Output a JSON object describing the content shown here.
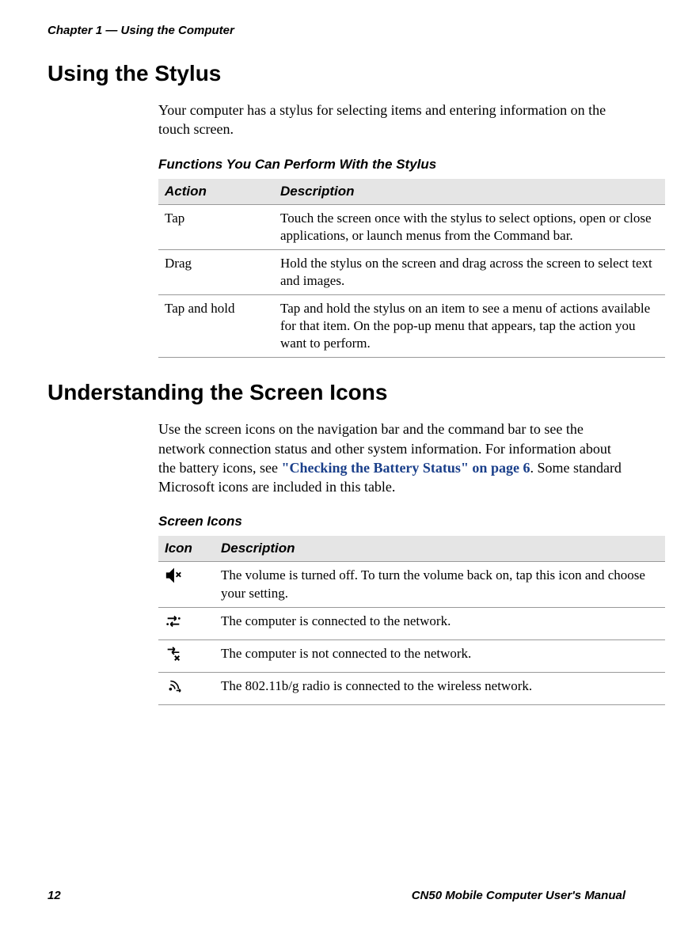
{
  "chapter_header": "Chapter 1 — Using the Computer",
  "section1": {
    "heading": "Using the Stylus",
    "intro": "Your computer has a stylus for selecting items and entering information on the touch screen.",
    "table_caption": "Functions You Can Perform With the Stylus",
    "table_head_action": "Action",
    "table_head_desc": "Description",
    "rows": [
      {
        "action": "Tap",
        "desc": "Touch the screen once with the stylus to select options, open or close applications, or launch menus from the Command bar."
      },
      {
        "action": "Drag",
        "desc": "Hold the stylus on the screen and drag across the screen to select text and images."
      },
      {
        "action": "Tap and hold",
        "desc": "Tap and hold the stylus on an item to see a menu of actions available for that item. On the pop-up menu that appears, tap the action you want to perform."
      }
    ]
  },
  "section2": {
    "heading": "Understanding the Screen Icons",
    "intro_before": "Use the screen icons on the navigation bar and the command bar to see the network connection status and other system information. For information about the battery icons, see ",
    "link_text": "\"Checking the Battery Status\" on page 6",
    "intro_after": ". Some standard Microsoft icons are included in this table.",
    "table_caption": "Screen Icons",
    "table_head_icon": "Icon",
    "table_head_desc": "Description",
    "rows": [
      {
        "icon": "volume-off-icon",
        "desc": "The volume is turned off. To turn the volume back on, tap this icon and choose your setting."
      },
      {
        "icon": "network-connected-icon",
        "desc": "The computer is connected to the network."
      },
      {
        "icon": "network-disconnected-icon",
        "desc": "The computer is not connected to the network."
      },
      {
        "icon": "wifi-connected-icon",
        "desc": "The 802.11b/g radio is connected to the wireless network."
      }
    ]
  },
  "footer": {
    "page_number": "12",
    "doc_title": "CN50 Mobile Computer User's Manual"
  }
}
